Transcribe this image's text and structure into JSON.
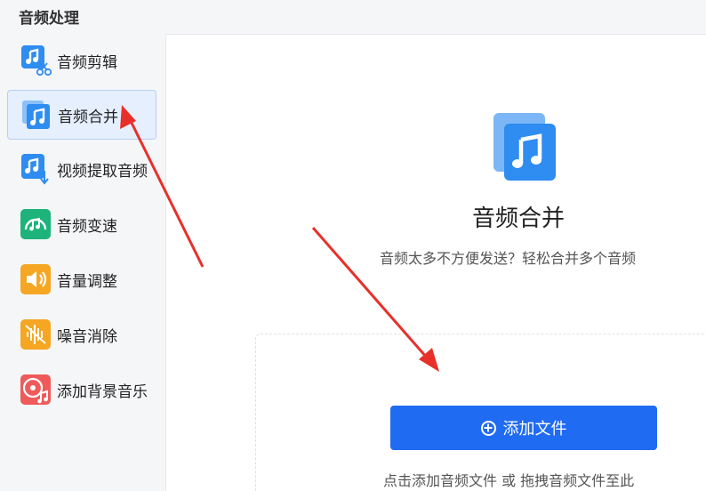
{
  "section_title": "音频处理",
  "sidebar": {
    "items": [
      {
        "label": "音频剪辑",
        "icon": "music-scissors-icon",
        "color": "#2f8cf0",
        "active": false
      },
      {
        "label": "音频合并",
        "icon": "music-stack-icon",
        "color": "#2f8cf0",
        "active": true
      },
      {
        "label": "视频提取音频",
        "icon": "music-download-icon",
        "color": "#2f8cf0",
        "active": false
      },
      {
        "label": "音频变速",
        "icon": "speed-gauge-icon",
        "color": "#1db37a",
        "active": false
      },
      {
        "label": "音量调整",
        "icon": "speaker-icon",
        "color": "#f5a623",
        "active": false
      },
      {
        "label": "噪音消除",
        "icon": "noise-wave-icon",
        "color": "#f5a623",
        "active": false
      },
      {
        "label": "添加背景音乐",
        "icon": "music-disc-icon",
        "color": "#ef5a5a",
        "active": false
      }
    ]
  },
  "main": {
    "title": "音频合并",
    "subtitle": "音频太多不方便发送？轻松合并多个音频",
    "add_button_label": "添加文件",
    "hint": "点击添加音频文件 或 拖拽音频文件至此"
  },
  "colors": {
    "accent": "#1f6bf2",
    "active_bg": "#e5effd",
    "arrow": "#e8302a"
  }
}
